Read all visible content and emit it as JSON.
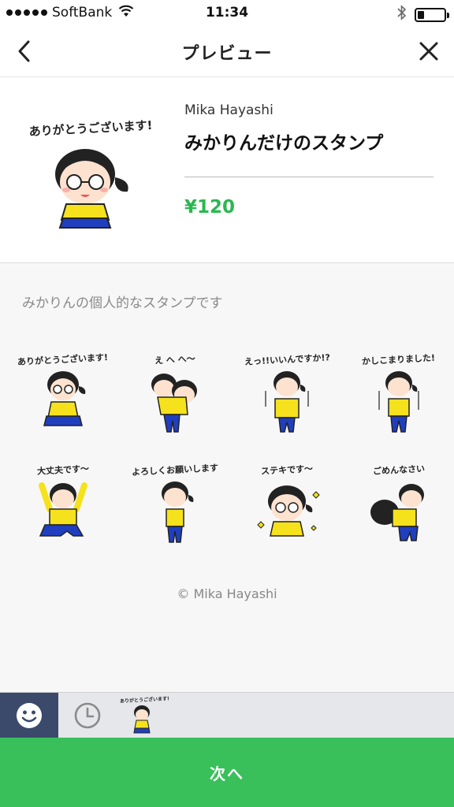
{
  "status_bar": {
    "carrier": "SoftBank",
    "time": "11:34",
    "battery_level": 0.25
  },
  "nav": {
    "title": "プレビュー"
  },
  "product": {
    "author": "Mika Hayashi",
    "title": "みかりんだけのスタンプ",
    "price": "¥120",
    "caption": "ありがとうございます!"
  },
  "description": "みかりんの個人的なスタンプです",
  "stickers": [
    {
      "caption": "ありがとうございます!"
    },
    {
      "caption": "え へ へ〜"
    },
    {
      "caption": "えっ!!いいんですか!?"
    },
    {
      "caption": "かしこまりました!"
    },
    {
      "caption": "大丈夫です〜"
    },
    {
      "caption": "よろしくお願いします"
    },
    {
      "caption": "ステキです〜"
    },
    {
      "caption": "ごめんなさい"
    }
  ],
  "copyright": "© Mika Hayashi",
  "tabs": {
    "thumb_caption": "ありがとうございます!"
  },
  "next_button": {
    "label": "次へ"
  },
  "colors": {
    "accent_green": "#39c05a",
    "price_green": "#2ab84f",
    "tab_active": "#3b4a6b"
  }
}
